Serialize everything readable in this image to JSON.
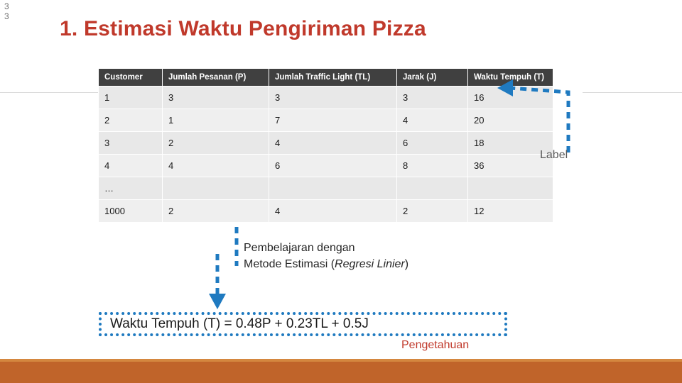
{
  "slide": {
    "number_lines": [
      "3",
      "3"
    ],
    "title": "1. Estimasi Waktu Pengiriman Pizza"
  },
  "table": {
    "headers": [
      "Customer",
      "Jumlah Pesanan (P)",
      "Jumlah Traffic Light (TL)",
      "Jarak (J)",
      "Waktu Tempuh (T)"
    ],
    "rows": [
      [
        "1",
        "3",
        "3",
        "3",
        "16"
      ],
      [
        "2",
        "1",
        "7",
        "4",
        "20"
      ],
      [
        "3",
        "2",
        "4",
        "6",
        "18"
      ],
      [
        "4",
        "4",
        "6",
        "8",
        "36"
      ],
      [
        "…",
        "",
        "",
        "",
        ""
      ],
      [
        "1000",
        "2",
        "4",
        "2",
        "12"
      ]
    ]
  },
  "annotations": {
    "label": "Label",
    "learning_line1": "Pembelajaran dengan",
    "learning_line2_pre": "Metode Estimasi (",
    "learning_line2_italic": "Regresi Linier",
    "learning_line2_post": ")",
    "formula": "Waktu Tempuh (T) = 0.48P + 0.23TL + 0.5J",
    "knowledge": "Pengetahuan"
  },
  "colors": {
    "title": "#c0392b",
    "header_bg": "#404040",
    "cell_bg": "#e8e8e8",
    "accent_blue": "#1f7ac0",
    "bottom_bar": "#c0642a"
  }
}
